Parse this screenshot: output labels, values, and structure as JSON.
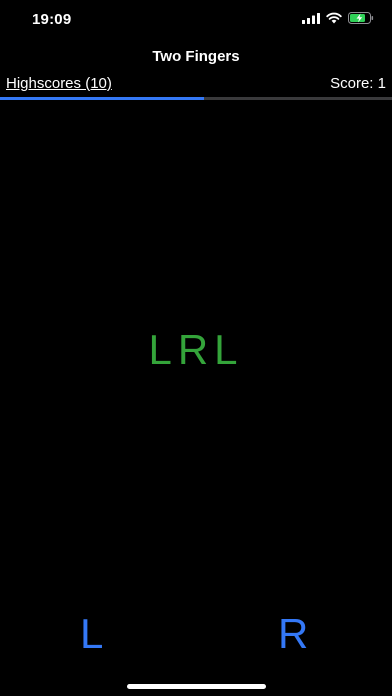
{
  "status_bar": {
    "time": "19:09",
    "icons": [
      "cellular-signal-icon",
      "wifi-icon",
      "battery-charging-icon"
    ]
  },
  "nav": {
    "title": "Two Fingers"
  },
  "header": {
    "highscores_label": "Highscores (10)",
    "score_label": "Score: 1"
  },
  "progress": {
    "fraction": 0.52,
    "color": "#3478f6"
  },
  "game": {
    "sequence": "LRL",
    "sequence_color": "#34a43a"
  },
  "controls": {
    "left_label": "L",
    "right_label": "R",
    "color": "#3478f6"
  }
}
